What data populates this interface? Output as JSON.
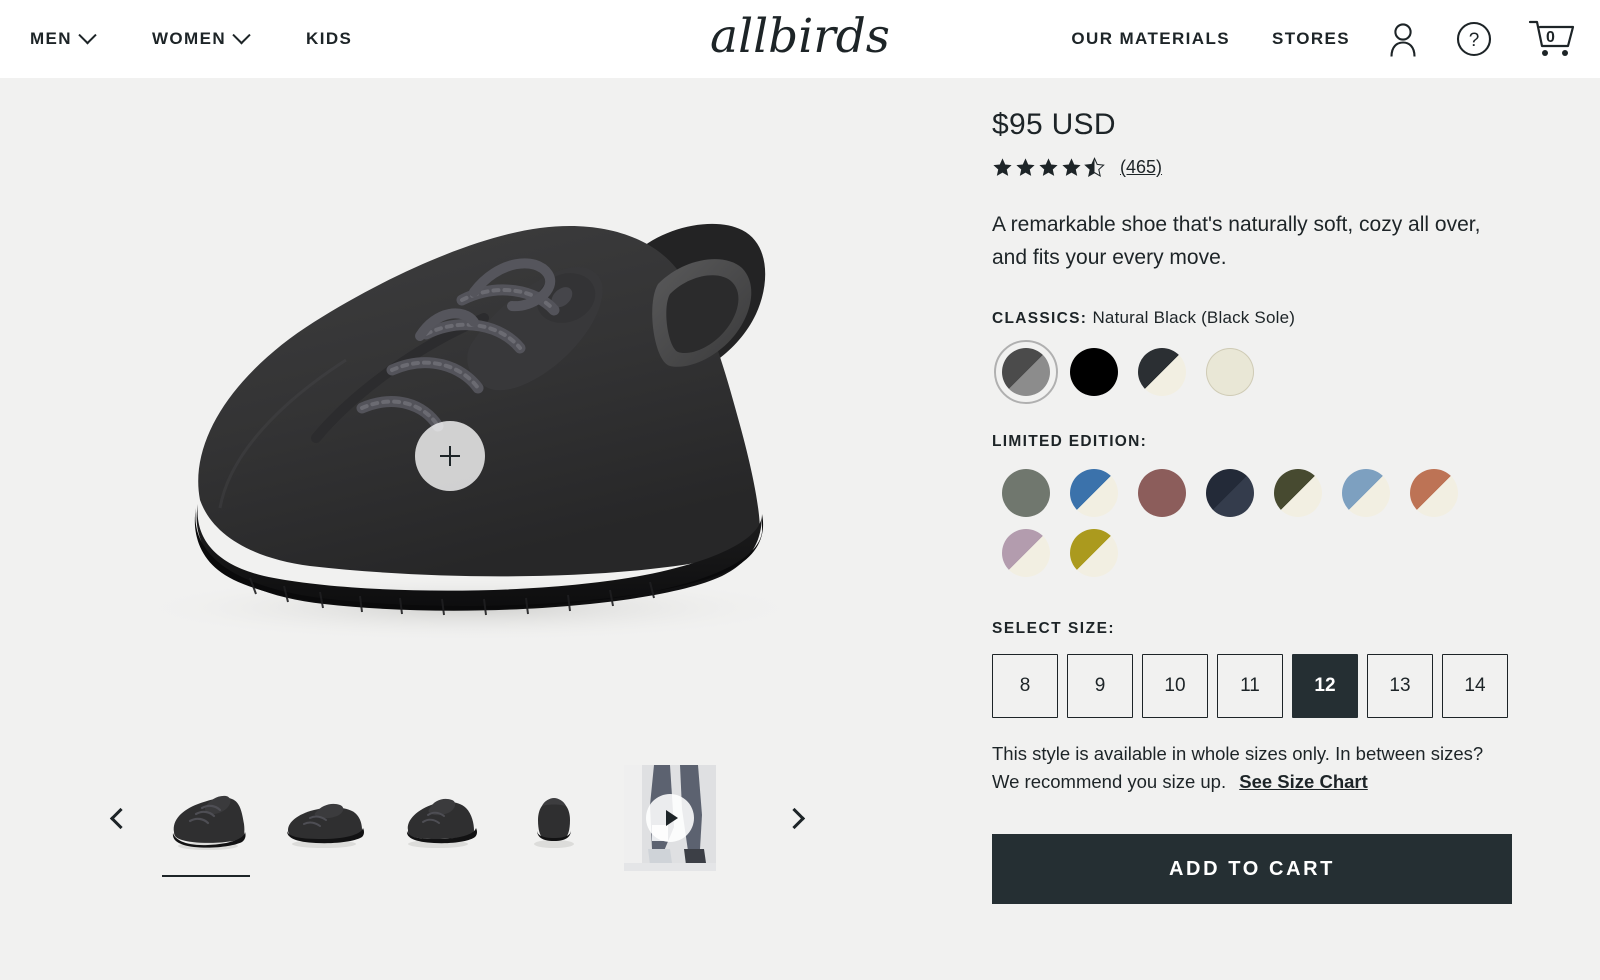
{
  "header": {
    "nav_left": [
      {
        "label": "MEN",
        "icon": "chevron-down-icon",
        "has_chevron": true
      },
      {
        "label": "WOMEN",
        "icon": "chevron-down-icon",
        "has_chevron": true
      },
      {
        "label": "KIDS",
        "has_chevron": false
      }
    ],
    "logo": "allbirds",
    "nav_right": [
      {
        "label": "OUR MATERIALS"
      },
      {
        "label": "STORES"
      }
    ],
    "icons": {
      "account": "user-icon",
      "help": "question-mark-icon",
      "cart": "shopping-cart-icon"
    },
    "cart_count": "0"
  },
  "gallery": {
    "zoom_hotspot": "+",
    "prev_label": "‹",
    "next_label": "›",
    "selected_index": 0,
    "thumbnails": [
      {
        "name": "three-quarter-view",
        "type": "image",
        "selected": true
      },
      {
        "name": "side-view",
        "type": "image",
        "selected": false
      },
      {
        "name": "angled-rear-view",
        "type": "image",
        "selected": false
      },
      {
        "name": "heel-view",
        "type": "image",
        "selected": false
      },
      {
        "name": "product-video",
        "type": "video",
        "selected": false
      }
    ]
  },
  "product": {
    "price": "$95 USD",
    "rating_value": 4.5,
    "stars_total": 5,
    "review_count": "(465)",
    "description": "A remarkable shoe that's naturally soft, cozy all over, and fits your every move.",
    "classics_label": "CLASSICS:",
    "classics_value": "Natural Black (Black Sole)",
    "classics_swatches": [
      {
        "name": "natural-grey",
        "type": "split",
        "top": "#4b4b4b",
        "bottom": "#8c8c8c",
        "selected": false,
        "bordered": false
      },
      {
        "name": "natural-black-black-sole",
        "type": "solid",
        "top": "#000000",
        "bottom": "#000000",
        "selected": true,
        "bordered": false
      },
      {
        "name": "natural-black-cream-sole",
        "type": "split",
        "top": "#2b2f33",
        "bottom": "#f2efe2",
        "selected": false,
        "bordered": false
      },
      {
        "name": "natural-white",
        "type": "solid",
        "top": "#e9e7d6",
        "bottom": "#e9e7d6",
        "selected": false,
        "bordered": true
      }
    ],
    "limited_label": "LIMITED EDITION:",
    "limited_swatches": [
      {
        "name": "sage-green",
        "type": "solid",
        "top": "#70776e",
        "bottom": "#70776e",
        "selected": false,
        "bordered": false
      },
      {
        "name": "blue-cream",
        "type": "split",
        "top": "#3b72ab",
        "bottom": "#f2efe2",
        "selected": false,
        "bordered": false
      },
      {
        "name": "rosewood",
        "type": "solid",
        "top": "#8c5d5b",
        "bottom": "#8c5d5b",
        "selected": false,
        "bordered": false
      },
      {
        "name": "navy",
        "type": "split",
        "top": "#232a38",
        "bottom": "#343c4c",
        "selected": false,
        "bordered": false
      },
      {
        "name": "olive-cream",
        "type": "split",
        "top": "#474a30",
        "bottom": "#f2efe2",
        "selected": false,
        "bordered": false
      },
      {
        "name": "sky-blue-cream",
        "type": "split",
        "top": "#7da0c0",
        "bottom": "#f2efe2",
        "selected": false,
        "bordered": false
      },
      {
        "name": "terracotta-cream",
        "type": "split",
        "top": "#bd7355",
        "bottom": "#f2efe2",
        "selected": false,
        "bordered": false
      },
      {
        "name": "mauve-cream",
        "type": "split",
        "top": "#b39cae",
        "bottom": "#f2efe2",
        "selected": false,
        "bordered": false
      },
      {
        "name": "mustard-cream",
        "type": "split",
        "top": "#ab9a1e",
        "bottom": "#f2efe2",
        "selected": false,
        "bordered": false
      }
    ],
    "size_label": "SELECT SIZE:",
    "sizes": [
      {
        "value": "8",
        "selected": false
      },
      {
        "value": "9",
        "selected": false
      },
      {
        "value": "10",
        "selected": false
      },
      {
        "value": "11",
        "selected": false
      },
      {
        "value": "12",
        "selected": true
      },
      {
        "value": "13",
        "selected": false
      },
      {
        "value": "14",
        "selected": false
      }
    ],
    "size_note": "This style is available in whole sizes only. In between sizes? We recommend you size up.",
    "size_chart_link": "See Size Chart",
    "add_to_cart_label": "ADD TO CART"
  },
  "colors": {
    "page_background": "#f1f1f0",
    "header_background": "#ffffff",
    "ink": "#1d2427",
    "accent_dark": "#252f33"
  }
}
